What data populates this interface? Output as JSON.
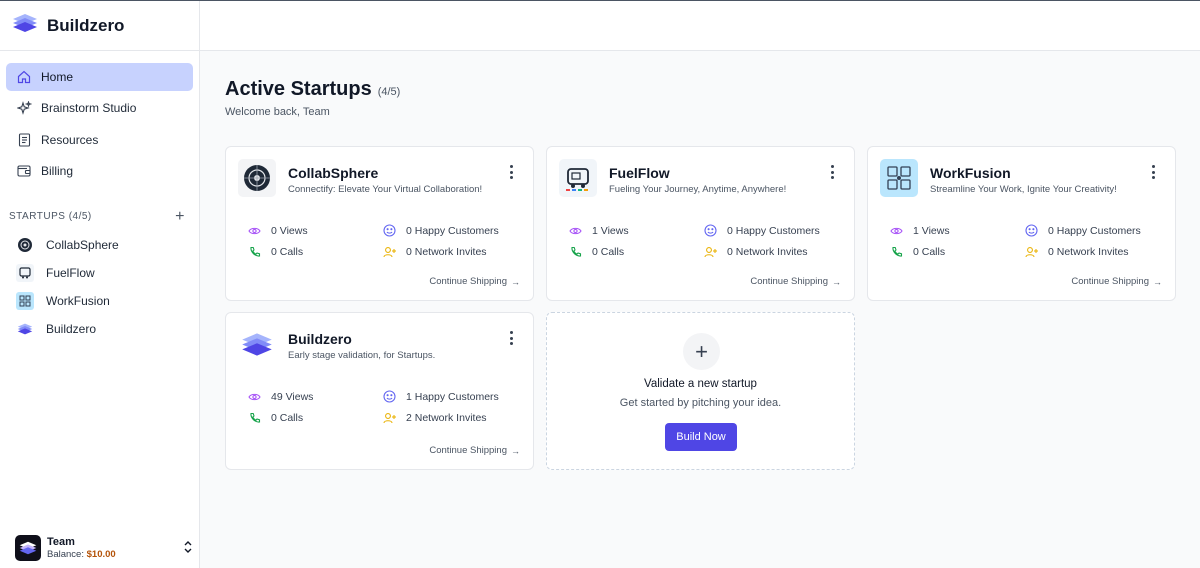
{
  "brand": {
    "name": "Buildzero"
  },
  "nav": {
    "items": [
      {
        "label": "Home",
        "icon": "home-icon",
        "active": true
      },
      {
        "label": "Brainstorm Studio",
        "icon": "sparkles-icon"
      },
      {
        "label": "Resources",
        "icon": "document-icon"
      },
      {
        "label": "Billing",
        "icon": "wallet-icon"
      }
    ]
  },
  "startups_section": {
    "label": "STARTUPS",
    "count": "(4/5)"
  },
  "startups": [
    {
      "label": "CollabSphere"
    },
    {
      "label": "FuelFlow"
    },
    {
      "label": "WorkFusion"
    },
    {
      "label": "Buildzero"
    }
  ],
  "team": {
    "name": "Team",
    "balance_label": "Balance:",
    "balance_value": "$10.00"
  },
  "page": {
    "title": "Active Startups",
    "count": "(4/5)",
    "welcome": "Welcome back, Team"
  },
  "cards": [
    {
      "name": "CollabSphere",
      "tagline": "Connectify: Elevate Your Virtual Collaboration!",
      "views": "0 Views",
      "calls": "0 Calls",
      "customers": "0 Happy Customers",
      "invites": "0 Network Invites",
      "continue": "Continue Shipping"
    },
    {
      "name": "FuelFlow",
      "tagline": "Fueling Your Journey, Anytime, Anywhere!",
      "views": "1 Views",
      "calls": "0 Calls",
      "customers": "0 Happy Customers",
      "invites": "0 Network Invites",
      "continue": "Continue Shipping"
    },
    {
      "name": "WorkFusion",
      "tagline": "Streamline Your Work, Ignite Your Creativity!",
      "views": "1 Views",
      "calls": "0 Calls",
      "customers": "0 Happy Customers",
      "invites": "0 Network Invites",
      "continue": "Continue Shipping"
    },
    {
      "name": "Buildzero",
      "tagline": "Early stage validation, for Startups.",
      "views": "49 Views",
      "calls": "0 Calls",
      "customers": "1 Happy Customers",
      "invites": "2 Network Invites",
      "continue": "Continue Shipping"
    }
  ],
  "new_startup": {
    "title": "Validate a new startup",
    "subtitle": "Get started by pitching your idea.",
    "button": "Build Now"
  },
  "colors": {
    "accent": "#4f46e5",
    "nav_active": "#c7d2fe",
    "views_icon": "#a855f7",
    "calls_icon": "#16a34a",
    "customers_icon": "#6366f1",
    "invites_icon": "#eab308",
    "balance": "#b45309"
  }
}
